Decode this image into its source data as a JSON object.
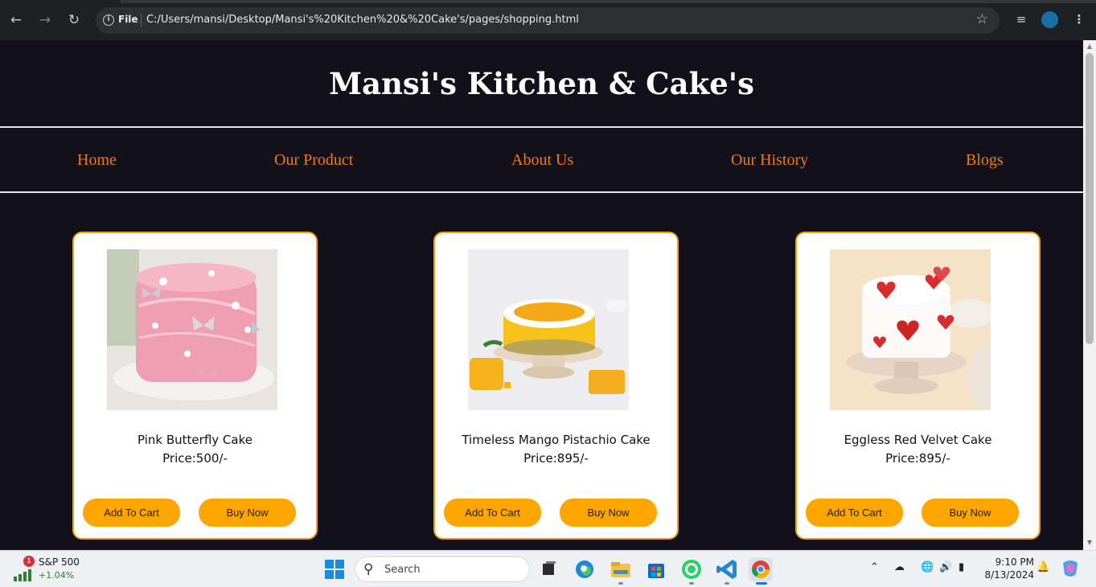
{
  "browser": {
    "file_label": "File",
    "url": "C:/Users/mansi/Desktop/Mansi's%20Kitchen%20&%20Cake's/pages/shopping.html"
  },
  "site": {
    "title": "Mansi's Kitchen & Cake's",
    "nav": [
      "Home",
      "Our Product",
      "About Us",
      "Our History",
      "Blogs"
    ]
  },
  "products": [
    {
      "name": "Pink Butterfly Cake",
      "price": "Price:500/-",
      "add_label": "Add To Cart",
      "buy_label": "Buy Now"
    },
    {
      "name": "Timeless Mango Pistachio Cake",
      "price": "Price:895/-",
      "add_label": "Add To Cart",
      "buy_label": "Buy Now"
    },
    {
      "name": "Eggless Red Velvet Cake",
      "price": "Price:895/-",
      "add_label": "Add To Cart",
      "buy_label": "Buy Now"
    }
  ],
  "taskbar": {
    "widget_badge": "1",
    "widget_name": "S&P 500",
    "widget_change": "+1.04%",
    "search_placeholder": "Search",
    "time": "9:10 PM",
    "date": "8/13/2024"
  },
  "colors": {
    "page_bg": "#11101b",
    "nav_link": "#f07b11",
    "card_border": "#f2a20b",
    "button": "#ffa500"
  }
}
